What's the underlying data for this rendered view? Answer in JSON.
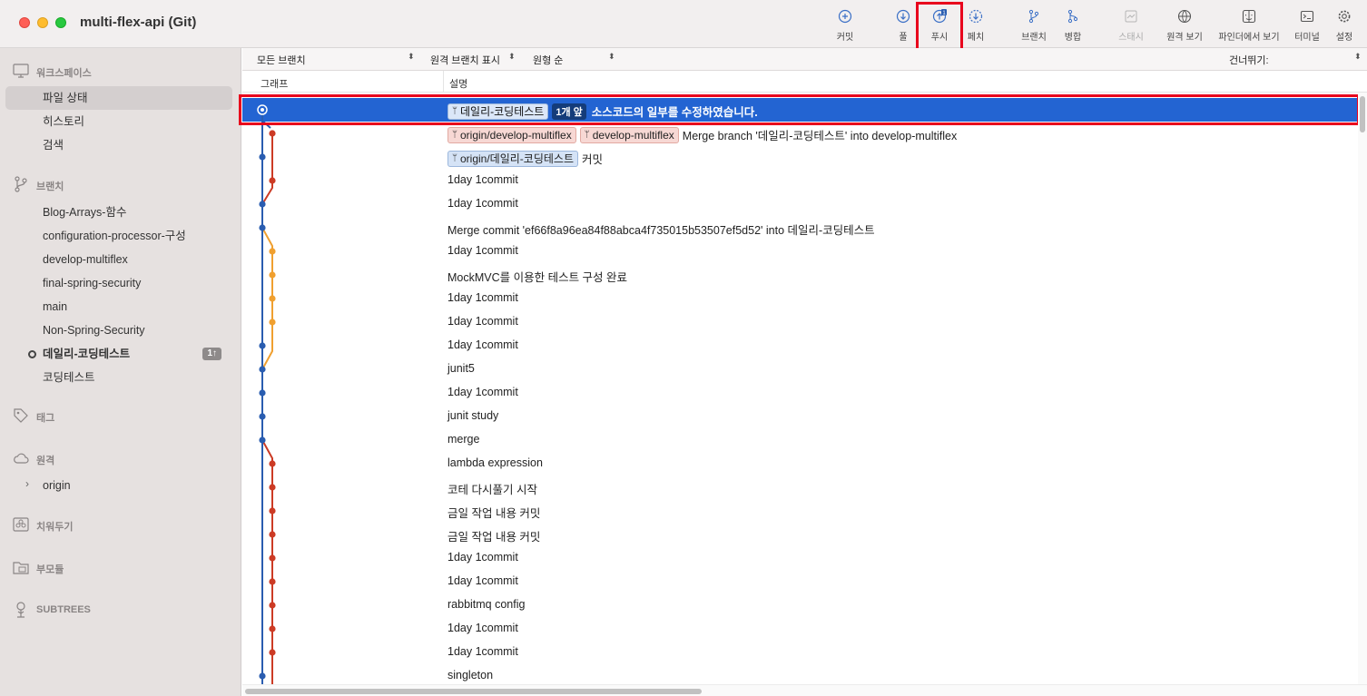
{
  "window": {
    "title": "multi-flex-api (Git)"
  },
  "toolbar": [
    {
      "label": "커밋",
      "icon": "commit-icon"
    },
    {
      "label": "풀",
      "icon": "pull-icon"
    },
    {
      "label": "푸시",
      "icon": "push-icon",
      "badge": "1"
    },
    {
      "label": "페치",
      "icon": "fetch-icon"
    },
    {
      "label": "브랜치",
      "icon": "branch-icon"
    },
    {
      "label": "병합",
      "icon": "merge-icon"
    },
    {
      "label": "스태시",
      "icon": "stash-icon"
    },
    {
      "label": "원격 보기",
      "icon": "globe-icon"
    },
    {
      "label": "파인더에서 보기",
      "icon": "finder-icon"
    },
    {
      "label": "터미널",
      "icon": "terminal-icon"
    },
    {
      "label": "설정",
      "icon": "gear-icon"
    }
  ],
  "sidebar": {
    "workspace": {
      "title": "워크스페이스",
      "items": [
        "파일 상태",
        "히스토리",
        "검색"
      ],
      "selected": "파일 상태"
    },
    "branches": {
      "title": "브랜치",
      "items": [
        "Blog-Arrays-함수",
        "configuration-processor-구성",
        "develop-multiflex",
        "final-spring-security",
        "main",
        "Non-Spring-Security",
        "데일리-코딩테스트",
        "코딩테스트"
      ],
      "current": "데일리-코딩테스트",
      "current_badge": "1↑"
    },
    "tags": {
      "title": "태그"
    },
    "remotes": {
      "title": "원격",
      "items": [
        "origin"
      ]
    },
    "stashes": {
      "title": "치워두기"
    },
    "submodules": {
      "title": "부모듈"
    },
    "subtrees": {
      "title": "SUBTREES"
    }
  },
  "filter": {
    "branches": "모든 브랜치",
    "remote": "원격 브랜치 표시",
    "order": "원형 순",
    "jump": "건너뛰기:"
  },
  "columns": {
    "graph": "그래프",
    "description": "설명"
  },
  "commits": [
    {
      "tags": [
        {
          "text": "데일리-코딩테스트",
          "kind": "local-blue"
        }
      ],
      "ahead": "1개 앞",
      "message": "소스코드의 일부를 수정하였습니다.",
      "selected": true
    },
    {
      "tags": [
        {
          "text": "origin/develop-multiflex",
          "kind": "remote-red"
        },
        {
          "text": "develop-multiflex",
          "kind": "remote-red"
        }
      ],
      "message": "Merge branch '데일리-코딩테스트' into develop-multiflex"
    },
    {
      "tags": [
        {
          "text": "origin/데일리-코딩테스트",
          "kind": "local-blue"
        }
      ],
      "message": "커밋"
    },
    {
      "tags": [],
      "message": "1day 1commit"
    },
    {
      "tags": [],
      "message": "1day 1commit"
    },
    {
      "tags": [],
      "message": "Merge commit 'ef66f8a96ea84f88abca4f735015b53507ef5d52' into 데일리-코딩테스트"
    },
    {
      "tags": [],
      "message": "1day 1commit"
    },
    {
      "tags": [],
      "message": "MockMVC를 이용한 테스트 구성 완료"
    },
    {
      "tags": [],
      "message": "1day 1commit"
    },
    {
      "tags": [],
      "message": "1day 1commit"
    },
    {
      "tags": [],
      "message": "1day 1commit"
    },
    {
      "tags": [],
      "message": "junit5"
    },
    {
      "tags": [],
      "message": "1day 1commit"
    },
    {
      "tags": [],
      "message": "junit study"
    },
    {
      "tags": [],
      "message": "merge"
    },
    {
      "tags": [],
      "message": "lambda expression"
    },
    {
      "tags": [],
      "message": "코테 다시풀기 시작"
    },
    {
      "tags": [],
      "message": "금일 작업 내용 커밋"
    },
    {
      "tags": [],
      "message": "금일 작업 내용 커밋"
    },
    {
      "tags": [],
      "message": "1day 1commit"
    },
    {
      "tags": [],
      "message": "1day 1commit"
    },
    {
      "tags": [],
      "message": "rabbitmq config"
    },
    {
      "tags": [],
      "message": "1day 1commit"
    },
    {
      "tags": [],
      "message": "1day 1commit"
    },
    {
      "tags": [],
      "message": "singleton"
    }
  ],
  "graph_lanes": {
    "colors": {
      "blue": "#2a5db0",
      "red": "#cc3b25",
      "orange": "#f0a030"
    }
  }
}
